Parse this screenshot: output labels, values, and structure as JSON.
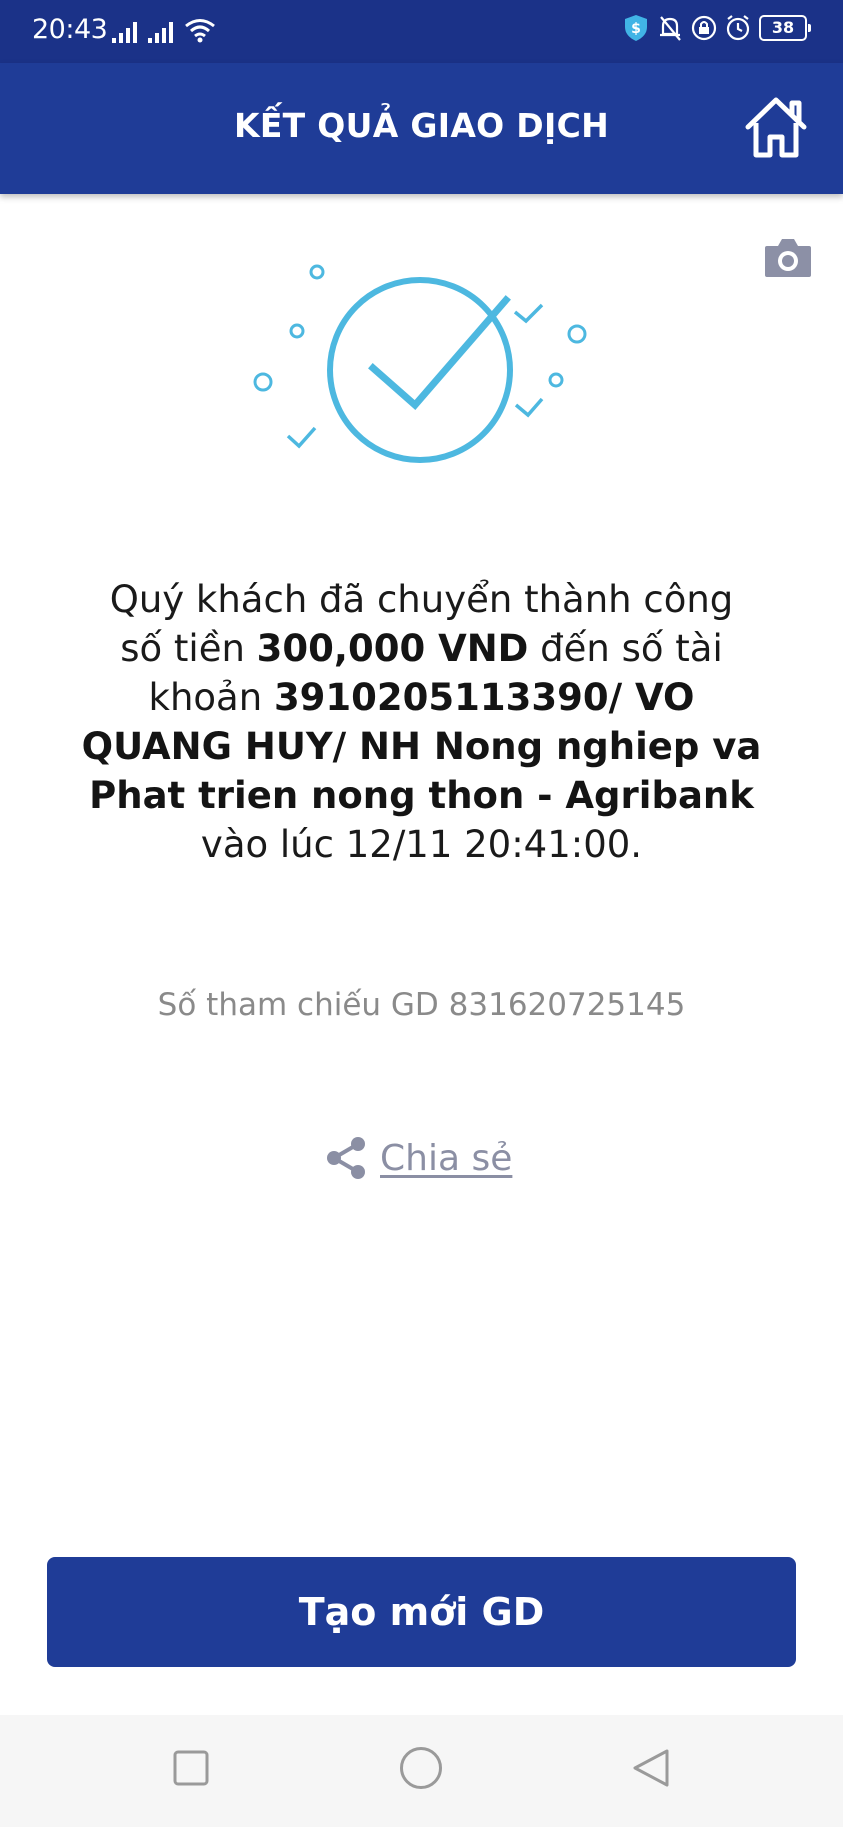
{
  "status_bar": {
    "time": "20:43",
    "battery": "38"
  },
  "header": {
    "title": "KẾT QUẢ GIAO DỊCH"
  },
  "result": {
    "line1": "Quý khách đã chuyển thành công",
    "amount_prefix": "số tiền ",
    "amount": "300,000 VND",
    "account_prefix": " đến số tài khoản ",
    "account": "3910205113390/ VO QUANG HUY/ NH Nong nghiep va Phat trien nong thon - Agribank",
    "time_prefix": " vào lúc ",
    "time": "12/11 20:41:00."
  },
  "reference": {
    "text": "Số tham chiếu GD 831620725145"
  },
  "share": {
    "label": "Chia sẻ"
  },
  "actions": {
    "new_transaction": "Tạo mới GD"
  },
  "colors": {
    "primary": "#1f3c97",
    "status_bar": "#1b3288",
    "success_accent": "#4db8e0",
    "muted": "#8a8a8a"
  },
  "icons": {
    "home": "home-icon",
    "camera": "camera-icon",
    "share": "share-icon",
    "success": "check-circle-icon"
  }
}
